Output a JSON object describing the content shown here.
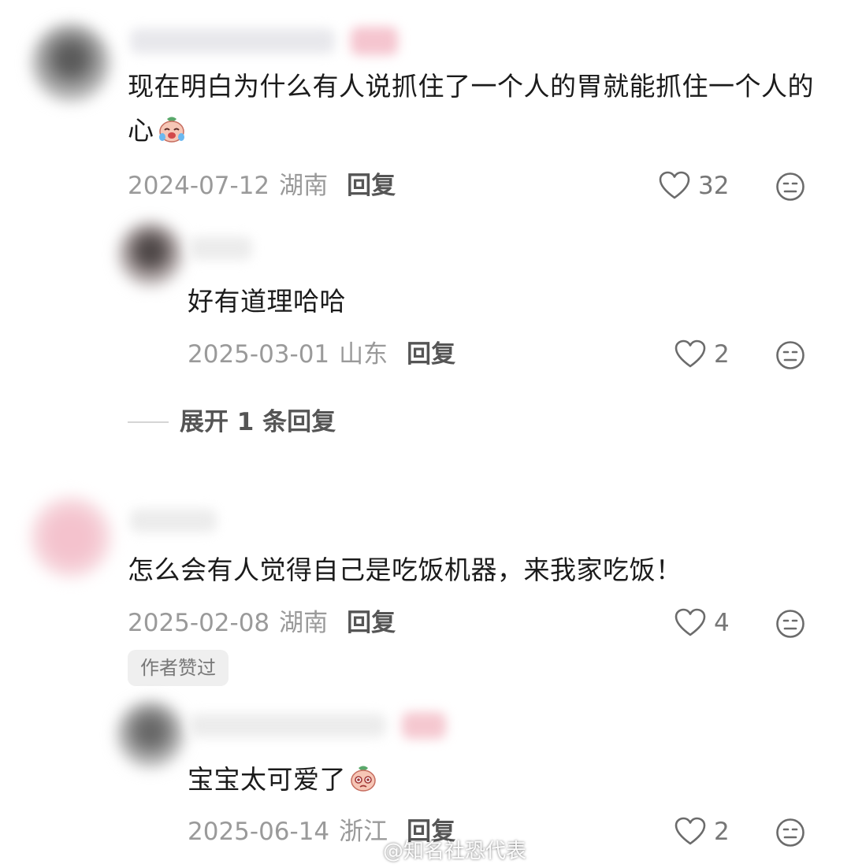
{
  "comments": [
    {
      "text": "现在明白为什么有人说抓住了一个人的胃就能抓住一个人的心",
      "emoji": "crying-face-emoji",
      "date": "2024-07-12",
      "location": "湖南",
      "reply_label": "回复",
      "likes": "32",
      "replies": [
        {
          "text": "好有道理哈哈",
          "date": "2025-03-01",
          "location": "山东",
          "reply_label": "回复",
          "likes": "2"
        }
      ],
      "expand_label": "展开 1 条回复"
    },
    {
      "text": "怎么会有人觉得自己是吃饭机器，来我家吃饭！",
      "date": "2025-02-08",
      "location": "湖南",
      "reply_label": "回复",
      "likes": "4",
      "badge": "作者赞过",
      "replies": [
        {
          "text": "宝宝太可爱了",
          "emoji": "pleading-face-emoji",
          "date": "2025-06-14",
          "location": "浙江",
          "reply_label": "回复",
          "likes": "2"
        }
      ]
    }
  ],
  "watermark": "@知名社恐代表",
  "colors": {
    "text": "#1b1b1b",
    "meta": "#9a9a9a",
    "badge_bg": "#efefef"
  }
}
